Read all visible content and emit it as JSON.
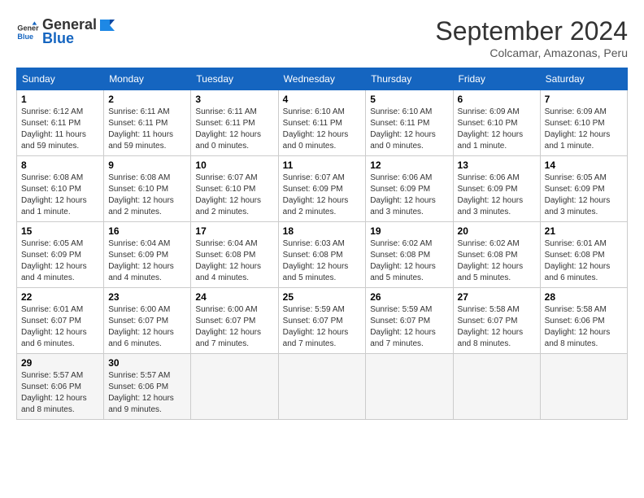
{
  "header": {
    "logo_general": "General",
    "logo_blue": "Blue",
    "month_year": "September 2024",
    "location": "Colcamar, Amazonas, Peru"
  },
  "days_of_week": [
    "Sunday",
    "Monday",
    "Tuesday",
    "Wednesday",
    "Thursday",
    "Friday",
    "Saturday"
  ],
  "weeks": [
    [
      {
        "day": "1",
        "sunrise": "6:12 AM",
        "sunset": "6:11 PM",
        "daylight": "11 hours and 59 minutes."
      },
      {
        "day": "2",
        "sunrise": "6:11 AM",
        "sunset": "6:11 PM",
        "daylight": "11 hours and 59 minutes."
      },
      {
        "day": "3",
        "sunrise": "6:11 AM",
        "sunset": "6:11 PM",
        "daylight": "12 hours and 0 minutes."
      },
      {
        "day": "4",
        "sunrise": "6:10 AM",
        "sunset": "6:11 PM",
        "daylight": "12 hours and 0 minutes."
      },
      {
        "day": "5",
        "sunrise": "6:10 AM",
        "sunset": "6:11 PM",
        "daylight": "12 hours and 0 minutes."
      },
      {
        "day": "6",
        "sunrise": "6:09 AM",
        "sunset": "6:10 PM",
        "daylight": "12 hours and 1 minute."
      },
      {
        "day": "7",
        "sunrise": "6:09 AM",
        "sunset": "6:10 PM",
        "daylight": "12 hours and 1 minute."
      }
    ],
    [
      {
        "day": "8",
        "sunrise": "6:08 AM",
        "sunset": "6:10 PM",
        "daylight": "12 hours and 1 minute."
      },
      {
        "day": "9",
        "sunrise": "6:08 AM",
        "sunset": "6:10 PM",
        "daylight": "12 hours and 2 minutes."
      },
      {
        "day": "10",
        "sunrise": "6:07 AM",
        "sunset": "6:10 PM",
        "daylight": "12 hours and 2 minutes."
      },
      {
        "day": "11",
        "sunrise": "6:07 AM",
        "sunset": "6:09 PM",
        "daylight": "12 hours and 2 minutes."
      },
      {
        "day": "12",
        "sunrise": "6:06 AM",
        "sunset": "6:09 PM",
        "daylight": "12 hours and 3 minutes."
      },
      {
        "day": "13",
        "sunrise": "6:06 AM",
        "sunset": "6:09 PM",
        "daylight": "12 hours and 3 minutes."
      },
      {
        "day": "14",
        "sunrise": "6:05 AM",
        "sunset": "6:09 PM",
        "daylight": "12 hours and 3 minutes."
      }
    ],
    [
      {
        "day": "15",
        "sunrise": "6:05 AM",
        "sunset": "6:09 PM",
        "daylight": "12 hours and 4 minutes."
      },
      {
        "day": "16",
        "sunrise": "6:04 AM",
        "sunset": "6:09 PM",
        "daylight": "12 hours and 4 minutes."
      },
      {
        "day": "17",
        "sunrise": "6:04 AM",
        "sunset": "6:08 PM",
        "daylight": "12 hours and 4 minutes."
      },
      {
        "day": "18",
        "sunrise": "6:03 AM",
        "sunset": "6:08 PM",
        "daylight": "12 hours and 5 minutes."
      },
      {
        "day": "19",
        "sunrise": "6:02 AM",
        "sunset": "6:08 PM",
        "daylight": "12 hours and 5 minutes."
      },
      {
        "day": "20",
        "sunrise": "6:02 AM",
        "sunset": "6:08 PM",
        "daylight": "12 hours and 5 minutes."
      },
      {
        "day": "21",
        "sunrise": "6:01 AM",
        "sunset": "6:08 PM",
        "daylight": "12 hours and 6 minutes."
      }
    ],
    [
      {
        "day": "22",
        "sunrise": "6:01 AM",
        "sunset": "6:07 PM",
        "daylight": "12 hours and 6 minutes."
      },
      {
        "day": "23",
        "sunrise": "6:00 AM",
        "sunset": "6:07 PM",
        "daylight": "12 hours and 6 minutes."
      },
      {
        "day": "24",
        "sunrise": "6:00 AM",
        "sunset": "6:07 PM",
        "daylight": "12 hours and 7 minutes."
      },
      {
        "day": "25",
        "sunrise": "5:59 AM",
        "sunset": "6:07 PM",
        "daylight": "12 hours and 7 minutes."
      },
      {
        "day": "26",
        "sunrise": "5:59 AM",
        "sunset": "6:07 PM",
        "daylight": "12 hours and 7 minutes."
      },
      {
        "day": "27",
        "sunrise": "5:58 AM",
        "sunset": "6:07 PM",
        "daylight": "12 hours and 8 minutes."
      },
      {
        "day": "28",
        "sunrise": "5:58 AM",
        "sunset": "6:06 PM",
        "daylight": "12 hours and 8 minutes."
      }
    ],
    [
      {
        "day": "29",
        "sunrise": "5:57 AM",
        "sunset": "6:06 PM",
        "daylight": "12 hours and 8 minutes."
      },
      {
        "day": "30",
        "sunrise": "5:57 AM",
        "sunset": "6:06 PM",
        "daylight": "12 hours and 9 minutes."
      },
      null,
      null,
      null,
      null,
      null
    ]
  ],
  "labels": {
    "sunrise": "Sunrise:",
    "sunset": "Sunset:",
    "daylight": "Daylight:"
  }
}
